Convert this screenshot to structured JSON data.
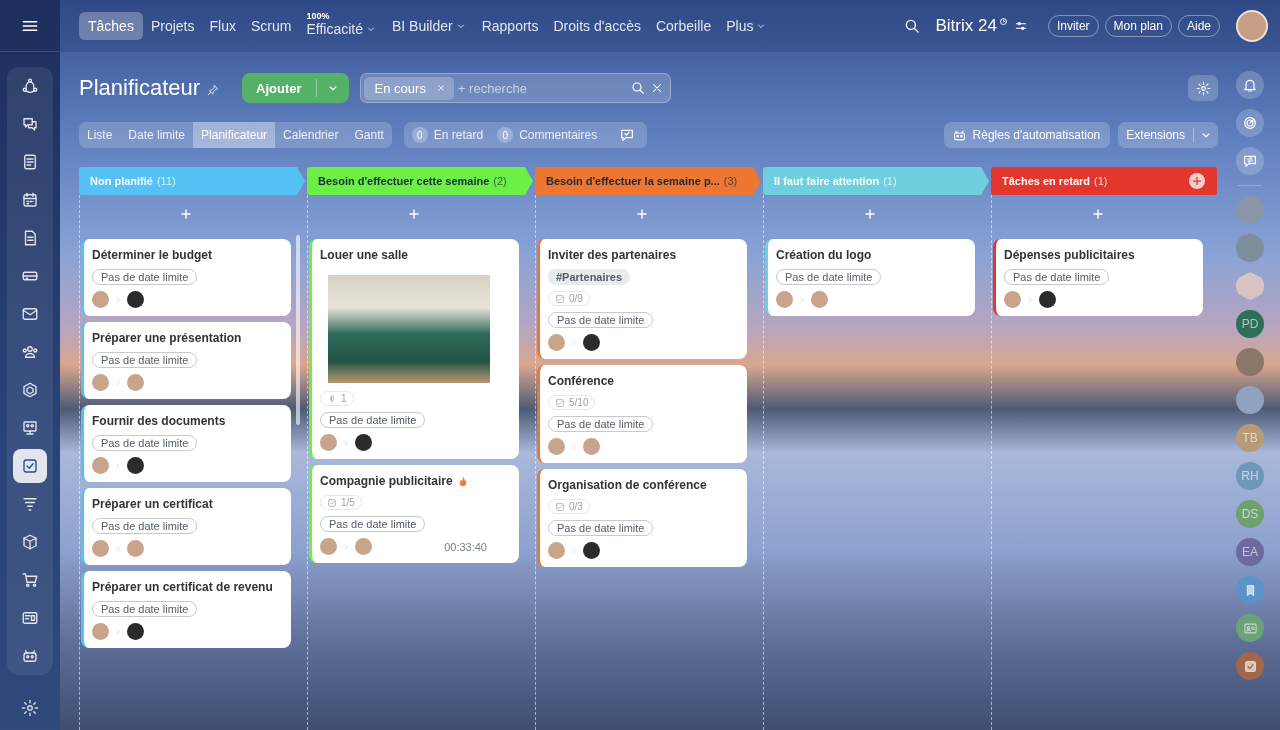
{
  "sidebar": {
    "items": [
      {
        "selected": false
      },
      {
        "selected": false
      },
      {
        "selected": false
      },
      {
        "selected": false
      },
      {
        "selected": false
      },
      {
        "selected": false
      },
      {
        "selected": false
      },
      {
        "selected": false
      },
      {
        "selected": false
      },
      {
        "selected": false
      },
      {
        "selected": true
      },
      {
        "selected": false
      },
      {
        "selected": false
      },
      {
        "selected": false
      },
      {
        "selected": false
      },
      {
        "selected": false
      }
    ]
  },
  "top_nav": {
    "items": [
      {
        "label": "Tâches",
        "selected": true,
        "dropdown": false
      },
      {
        "label": "Projets",
        "selected": false,
        "dropdown": false
      },
      {
        "label": "Flux",
        "selected": false,
        "dropdown": false
      },
      {
        "label": "Scrum",
        "selected": false,
        "dropdown": false
      },
      {
        "label": "Efficacité",
        "selected": false,
        "dropdown": true,
        "badge": "100%"
      },
      {
        "label": "BI Builder",
        "selected": false,
        "dropdown": true
      },
      {
        "label": "Rapports",
        "selected": false,
        "dropdown": false
      },
      {
        "label": "Droits d'accès",
        "selected": false,
        "dropdown": false
      },
      {
        "label": "Corbeille",
        "selected": false,
        "dropdown": false
      },
      {
        "label": "Plus",
        "selected": false,
        "dropdown": true
      }
    ],
    "logo": "Bitrix 24",
    "buttons": [
      "Inviter",
      "Mon plan",
      "Aide"
    ]
  },
  "header": {
    "title": "Planificateur",
    "add_button": "Ajouter",
    "filter": {
      "chip": "En cours",
      "placeholder": "+ recherche"
    }
  },
  "views": [
    {
      "label": "Liste",
      "selected": false
    },
    {
      "label": "Date limite",
      "selected": false
    },
    {
      "label": "Planificateur",
      "selected": true
    },
    {
      "label": "Calendrier",
      "selected": false
    },
    {
      "label": "Gantt",
      "selected": false
    }
  ],
  "counters": [
    {
      "count": "0",
      "label": "En retard"
    },
    {
      "count": "0",
      "label": "Commentaires"
    }
  ],
  "automation_button": "Règles d'automatisation",
  "extensions_button": "Extensions",
  "columns": [
    {
      "title": "Non planifié",
      "count": "(11)",
      "color": "#55c1f5",
      "cards": [
        {
          "title": "Déterminer le budget",
          "deadline": "Pas de date limite"
        },
        {
          "title": "Préparer une présentation",
          "deadline": "Pas de date limite"
        },
        {
          "title": "Fournir des documents",
          "deadline": "Pas de date limite"
        },
        {
          "title": "Préparer un certificat",
          "deadline": "Pas de date limite"
        },
        {
          "title": "Préparer un certificat de revenu",
          "deadline": "Pas de date limite"
        }
      ]
    },
    {
      "title": "Besoin d'effectuer cette semaine",
      "count": "(2)",
      "color": "#6cf046",
      "cards": [
        {
          "title": "Louer une salle",
          "photo": true,
          "attachments": "1",
          "deadline": "Pas de date limite"
        },
        {
          "title": "Compagnie publicitaire",
          "hot": true,
          "checklist": "1/5",
          "deadline": "Pas de date limite",
          "timer": "00:33:40"
        }
      ]
    },
    {
      "title": "Besoin d'effectuer la semaine p...",
      "count": "(3)",
      "color": "#ee7631",
      "cards": [
        {
          "title": "Inviter des partenaires",
          "tag": "#Partenaires",
          "checklist": "0/9",
          "deadline": "Pas de date limite"
        },
        {
          "title": "Conférence",
          "checklist": "5/10",
          "deadline": "Pas de date limite"
        },
        {
          "title": "Organisation de conférence",
          "checklist": "0/3",
          "deadline": "Pas de date limite"
        }
      ]
    },
    {
      "title": "Il faut faire attention",
      "count": "(1)",
      "color": "#6ecfdf",
      "cards": [
        {
          "title": "Création du logo",
          "deadline": "Pas de date limite"
        }
      ]
    },
    {
      "title": "Tâches en retard",
      "count": "(1)",
      "color": "#e3362c",
      "add_icon": true,
      "cards": [
        {
          "title": "Dépenses publicitaires",
          "deadline": "Pas de date limite"
        }
      ]
    }
  ],
  "right_panel": {
    "items": [
      {
        "kind": "bell"
      },
      {
        "kind": "target"
      },
      {
        "kind": "chat"
      },
      {
        "kind": "photo",
        "color": "#8a96a8"
      },
      {
        "kind": "photo",
        "color": "#7d8f9a"
      },
      {
        "kind": "hexagon",
        "color": "#d9c4c4"
      },
      {
        "kind": "initials",
        "initials": "PD",
        "color": "#2f6f57"
      },
      {
        "kind": "photo",
        "color": "#8a7768"
      },
      {
        "kind": "photo",
        "color": "#8fa3bf"
      },
      {
        "kind": "initials",
        "initials": "TB",
        "color": "#b79a78"
      },
      {
        "kind": "initials",
        "initials": "RH",
        "color": "#6f97b8"
      },
      {
        "kind": "initials",
        "initials": "DS",
        "color": "#6fa070"
      },
      {
        "kind": "initials",
        "initials": "EA",
        "color": "#6c6a9e"
      },
      {
        "kind": "bookmark",
        "color": "#5b93c9"
      },
      {
        "kind": "contact",
        "color": "#6aa37a"
      },
      {
        "kind": "tasks",
        "color": "#a0674a"
      }
    ]
  }
}
